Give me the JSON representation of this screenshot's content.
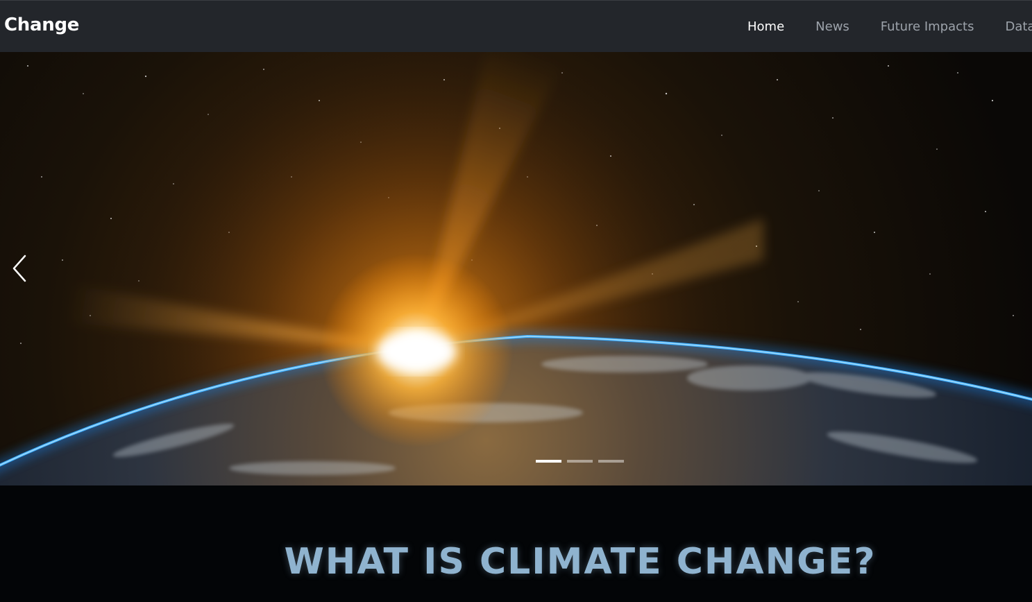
{
  "navbar": {
    "brand": "Change",
    "links": [
      {
        "label": "Home",
        "active": true
      },
      {
        "label": "News",
        "active": false
      },
      {
        "label": "Future Impacts",
        "active": false
      },
      {
        "label": "Data",
        "active": false
      }
    ]
  },
  "carousel": {
    "image": "earth-sunrise-from-space",
    "slide_count": 3,
    "active_slide": 1
  },
  "section": {
    "title": "WHAT IS CLIMATE CHANGE?"
  },
  "colors": {
    "navbar_bg": "#23262b",
    "title_color": "#8fb3cf",
    "atmosphere": "#1e8fff",
    "sun": "#ffae33"
  }
}
